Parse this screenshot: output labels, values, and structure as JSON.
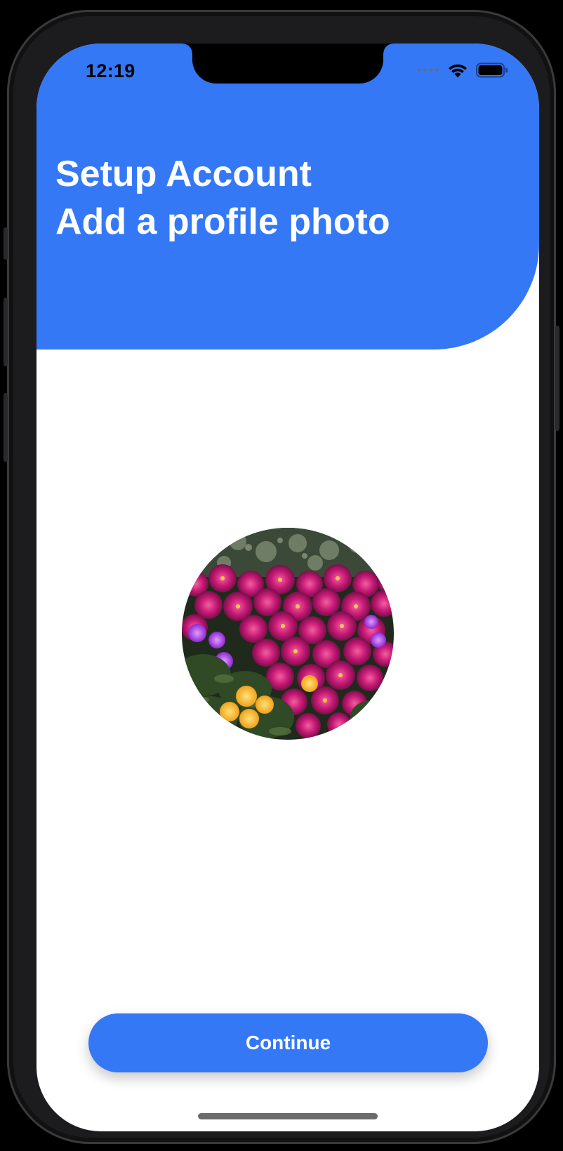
{
  "status_bar": {
    "time": "12:19",
    "icons": [
      "signal-dots-icon",
      "wifi-icon",
      "battery-icon"
    ]
  },
  "header": {
    "title": "Setup Account",
    "subtitle": "Add a profile photo"
  },
  "profile_photo": {
    "description_icon": "flower-photo"
  },
  "actions": {
    "continue_label": "Continue"
  },
  "colors": {
    "accent": "#3478f6",
    "background": "#ffffff",
    "text_on_accent": "#ffffff"
  }
}
